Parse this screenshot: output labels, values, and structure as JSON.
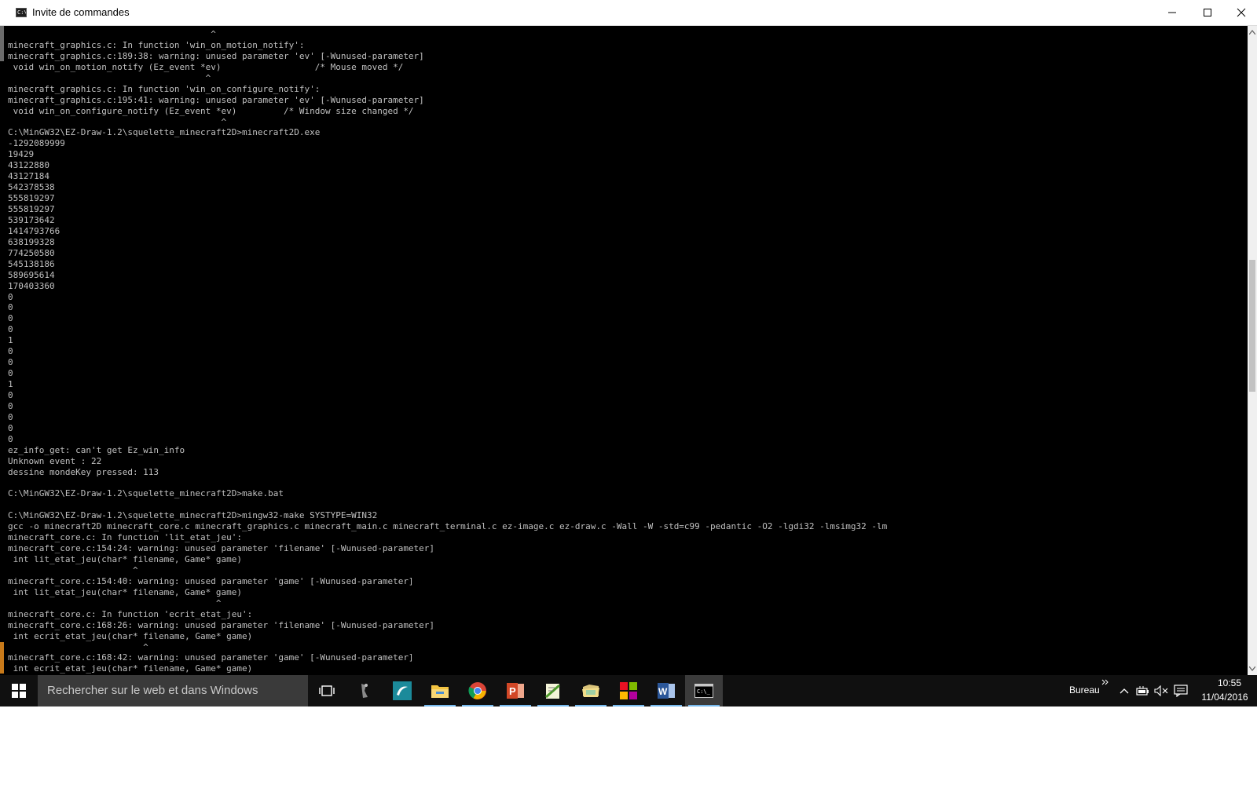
{
  "window": {
    "title": "Invite de commandes",
    "icon": "console-icon",
    "icon_glyph": "C:\\",
    "controls": {
      "minimize": "minimize-icon",
      "maximize": "maximize-icon",
      "close": "close-icon"
    }
  },
  "console": {
    "background": "#000000",
    "foreground": "#c0c0c0",
    "lines": [
      "                                       ^",
      "minecraft_graphics.c: In function 'win_on_motion_notify':",
      "minecraft_graphics.c:189:38: warning: unused parameter 'ev' [-Wunused-parameter]",
      " void win_on_motion_notify (Ez_event *ev)                  /* Mouse moved */",
      "                                      ^",
      "minecraft_graphics.c: In function 'win_on_configure_notify':",
      "minecraft_graphics.c:195:41: warning: unused parameter 'ev' [-Wunused-parameter]",
      " void win_on_configure_notify (Ez_event *ev)         /* Window size changed */",
      "                                         ^",
      "C:\\MinGW32\\EZ-Draw-1.2\\squelette_minecraft2D>minecraft2D.exe",
      "-1292089999",
      "19429",
      "43122880",
      "43127184",
      "542378538",
      "555819297",
      "555819297",
      "539173642",
      "1414793766",
      "638199328",
      "774250580",
      "545138186",
      "589695614",
      "170403360",
      "0",
      "0",
      "0",
      "0",
      "1",
      "0",
      "0",
      "0",
      "1",
      "0",
      "0",
      "0",
      "0",
      "0",
      "ez_info_get: can't get Ez_win_info",
      "Unknown event : 22",
      "dessine mondeKey pressed: 113",
      "",
      "C:\\MinGW32\\EZ-Draw-1.2\\squelette_minecraft2D>make.bat",
      "",
      "C:\\MinGW32\\EZ-Draw-1.2\\squelette_minecraft2D>mingw32-make SYSTYPE=WIN32",
      "gcc -o minecraft2D minecraft_core.c minecraft_graphics.c minecraft_main.c minecraft_terminal.c ez-image.c ez-draw.c -Wall -W -std=c99 -pedantic -O2 -lgdi32 -lmsimg32 -lm",
      "minecraft_core.c: In function 'lit_etat_jeu':",
      "minecraft_core.c:154:24: warning: unused parameter 'filename' [-Wunused-parameter]",
      " int lit_etat_jeu(char* filename, Game* game)",
      "                        ^",
      "minecraft_core.c:154:40: warning: unused parameter 'game' [-Wunused-parameter]",
      " int lit_etat_jeu(char* filename, Game* game)",
      "                                        ^",
      "minecraft_core.c: In function 'ecrit_etat_jeu':",
      "minecraft_core.c:168:26: warning: unused parameter 'filename' [-Wunused-parameter]",
      " int ecrit_etat_jeu(char* filename, Game* game)",
      "                          ^",
      "minecraft_core.c:168:42: warning: unused parameter 'game' [-Wunused-parameter]",
      " int ecrit_etat_jeu(char* filename, Game* game)"
    ]
  },
  "scrollbar": {
    "position_fraction": 0.45,
    "up_icon": "scroll-up-arrow-icon",
    "down_icon": "scroll-down-arrow-icon"
  },
  "taskbar": {
    "start_icon": "windows-start-icon",
    "search_placeholder": "Rechercher sur le web et dans Windows",
    "apps": [
      {
        "name": "task-view-icon",
        "active": false,
        "running": false
      },
      {
        "name": "app-icon-1",
        "active": false,
        "running": false
      },
      {
        "name": "app-icon-2",
        "active": false,
        "running": false
      },
      {
        "name": "file-explorer-icon",
        "active": false,
        "running": true
      },
      {
        "name": "chrome-icon",
        "active": false,
        "running": true
      },
      {
        "name": "powerpoint-icon",
        "active": false,
        "running": true
      },
      {
        "name": "notepad-plus-icon",
        "active": false,
        "running": true
      },
      {
        "name": "folder-icon",
        "active": false,
        "running": true
      },
      {
        "name": "app-icon-colored",
        "active": false,
        "running": true
      },
      {
        "name": "word-icon",
        "active": false,
        "running": true
      },
      {
        "name": "command-prompt-icon",
        "active": true,
        "running": true
      }
    ],
    "tray": {
      "desktop_label": "Bureau",
      "overflow_icon": "tray-overflow-icon",
      "show_hidden_icon": "chevron-up-icon",
      "battery_icon": "battery-icon",
      "volume_icon": "volume-muted-icon",
      "notifications_icon": "action-center-icon",
      "time": "10:55",
      "date": "11/04/2016"
    },
    "colors": {
      "background": "#101010",
      "search_background": "#3a3a3a",
      "running_indicator": "#76b9ed"
    }
  }
}
